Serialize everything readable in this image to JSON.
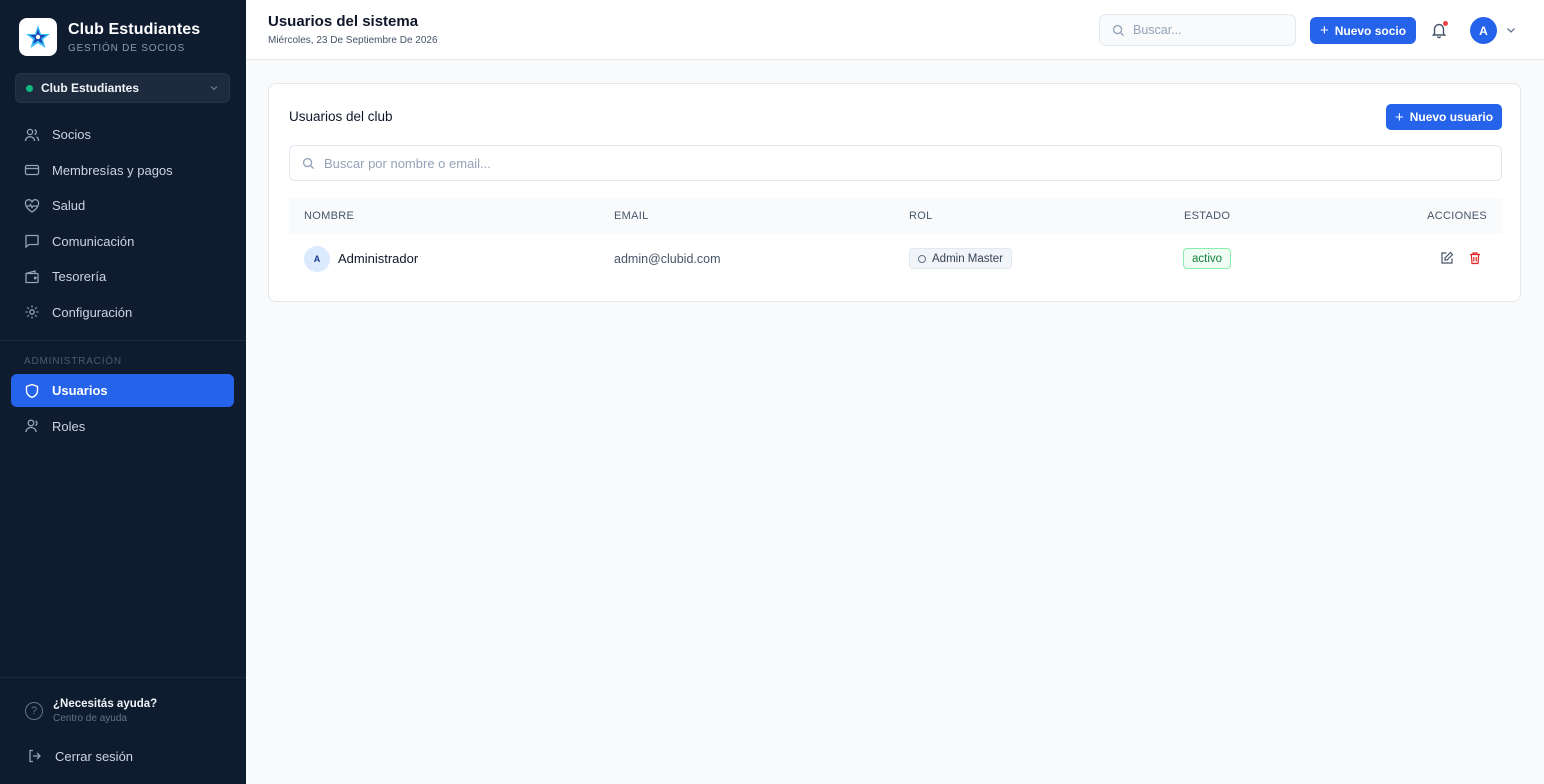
{
  "sidebar": {
    "brand_title": "Club Estudiantes",
    "brand_subtitle": "GESTIÓN DE SOCIOS",
    "club_selector": "Club Estudiantes",
    "items": [
      {
        "label": "Socios",
        "icon": "users-icon"
      },
      {
        "label": "Membresías y pagos",
        "icon": "credit-card-icon"
      },
      {
        "label": "Salud",
        "icon": "heart-pulse-icon"
      },
      {
        "label": "Comunicación",
        "icon": "message-icon"
      },
      {
        "label": "Tesorería",
        "icon": "wallet-icon"
      },
      {
        "label": "Configuración",
        "icon": "gear-icon"
      }
    ],
    "admin_section_label": "ADMINISTRACIÓN",
    "admin_items": [
      {
        "label": "Usuarios",
        "icon": "shield-icon",
        "active": true
      },
      {
        "label": "Roles",
        "icon": "user-icon",
        "active": false
      }
    ],
    "help_title": "¿Necesitás ayuda?",
    "help_subtitle": "Centro de ayuda",
    "logout_label": "Cerrar sesión"
  },
  "header": {
    "title": "Usuarios del sistema",
    "date": "Miércoles, 23 De Septiembre De 2026",
    "search_placeholder": "Buscar...",
    "new_member_label": "Nuevo socio",
    "avatar_initial": "A",
    "notification_dot_color": "#ef4444"
  },
  "card": {
    "title": "Usuarios del club",
    "new_user_label": "Nuevo usuario",
    "search_placeholder": "Buscar por nombre o email...",
    "columns": [
      "NOMBRE",
      "EMAIL",
      "ROL",
      "ESTADO",
      "ACCIONES"
    ],
    "rows": [
      {
        "initial": "A",
        "name": "Administrador",
        "email": "admin@clubid.com",
        "role": "Admin Master",
        "status": "activo"
      }
    ]
  },
  "colors": {
    "accent": "#2563eb",
    "sidebar_bg": "#0f1b2e",
    "status_active": "#15803d",
    "delete": "#dc2626"
  }
}
